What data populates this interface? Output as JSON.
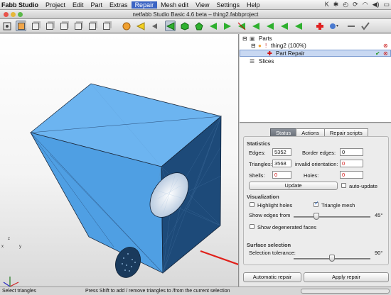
{
  "menubar": {
    "app_name": "Fabb Studio",
    "items": [
      "Project",
      "Edit",
      "Part",
      "Extras",
      "Repair",
      "Mesh edit",
      "View",
      "Settings",
      "Help"
    ],
    "active_item": "Repair"
  },
  "window": {
    "title": "netfabb Studio Basic 4.6 beta – thing2.fabbproject"
  },
  "tree": {
    "parts_label": "Parts",
    "part_name": "thing2 (100%)",
    "repair_item": "Part Repair",
    "slices_label": "Slices"
  },
  "repair_panel": {
    "tabs": [
      "Status",
      "Actions",
      "Repair scripts"
    ],
    "active_tab": "Status",
    "statistics": {
      "title": "Statistics",
      "edges_label": "Edges:",
      "edges_value": "5352",
      "border_edges_label": "Border edges:",
      "border_edges_value": "0",
      "triangles_label": "Triangles:",
      "triangles_value": "3568",
      "invalid_orientation_label": "invalid orientation:",
      "invalid_orientation_value": "0",
      "shells_label": "Shells:",
      "shells_value": "0",
      "holes_label": "Holes:",
      "holes_value": "0",
      "update_button": "Update",
      "auto_update_label": "auto-update"
    },
    "visualization": {
      "title": "Visualization",
      "highlight_holes_label": "Highlight holes",
      "triangle_mesh_label": "Triangle mesh",
      "show_edges_label": "Show edges from",
      "show_edges_value": "45°",
      "show_edges_fraction": 0.3,
      "degenerated_label": "Show degenerated faces"
    },
    "surface_selection": {
      "title": "Surface selection",
      "tolerance_label": "Selection tolerance:",
      "tolerance_value": "90°",
      "tolerance_fraction": 0.5
    },
    "automatic_repair_button": "Automatic repair",
    "apply_repair_button": "Apply repair"
  },
  "statusbar": {
    "left_text": "Select triangles",
    "hint_text": "Press Shift to add / remove triangles to /from the current selection"
  },
  "axes": {
    "x": "x",
    "y": "y",
    "z": "z"
  },
  "colors": {
    "part_blue": "#5aa9ea",
    "part_dark": "#1f4f7e",
    "annotation_red": "#e0201a",
    "menu_highlight": "#3b64c4"
  }
}
